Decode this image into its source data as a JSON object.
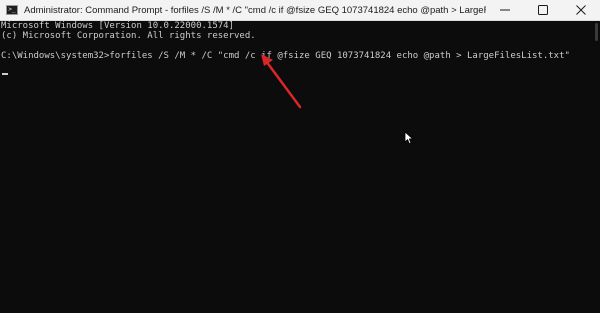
{
  "window": {
    "title": "Administrator: Command Prompt - forfiles  /S /M * /C \"cmd /c if @fsize GEQ 1073741824 echo @path > LargeFilesList.txt\"",
    "icon": "command-prompt-icon"
  },
  "caption_buttons": {
    "minimize_icon": "minimize-icon",
    "maximize_icon": "maximize-icon",
    "close_icon": "close-icon"
  },
  "console": {
    "lines": [
      "Microsoft Windows [Version 10.0.22000.1574]",
      "(c) Microsoft Corporation. All rights reserved.",
      "",
      "C:\\Windows\\system32>forfiles /S /M * /C \"cmd /c if @fsize GEQ 1073741824 echo @path > LargeFilesList.txt\""
    ]
  },
  "annotation": {
    "arrow_color": "#d9262b"
  },
  "colors": {
    "console_bg": "#0c0c0c",
    "console_text": "#cccccc",
    "titlebar_bg": "#f3f3f3"
  }
}
